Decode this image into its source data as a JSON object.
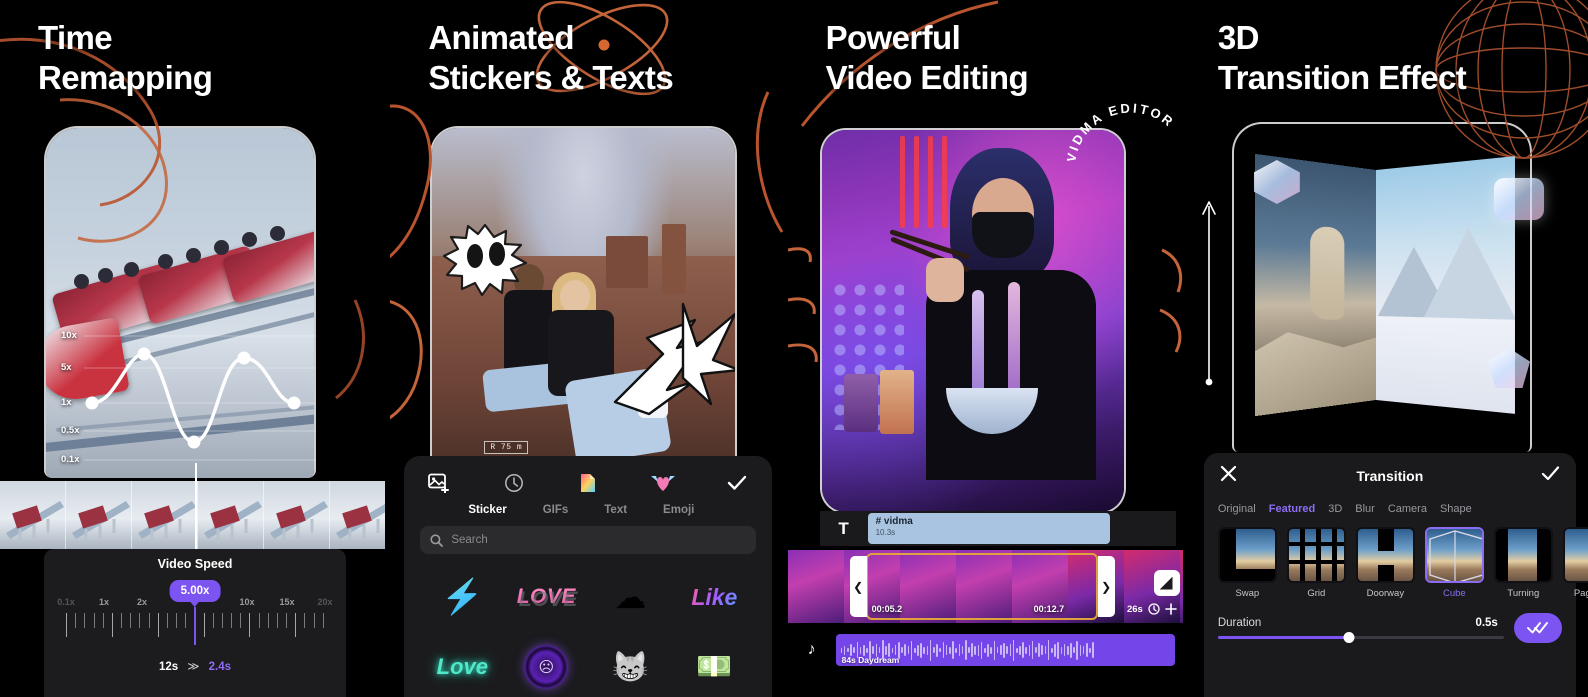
{
  "panels": [
    {
      "headline_line1": "Time",
      "headline_line2": "Remapping",
      "graph_labels": [
        "10x",
        "5x",
        "1x",
        "0.5x",
        "0.1x"
      ],
      "tray_title": "Video Speed",
      "ruler_labels": [
        "0.1x",
        "1x",
        "2x",
        "5x",
        "10x",
        "15x",
        "20x"
      ],
      "speed_badge": "5.00x",
      "duration_from": "12s",
      "duration_arrow": "≫",
      "duration_to": "2.4s"
    },
    {
      "headline_line1": "Animated",
      "headline_line2": "Stickers & Texts",
      "plate_label": "R 75 m",
      "toolbar": {
        "add_media_icon": "add-image-icon",
        "recent_icon": "clock-icon",
        "text_icon": "text-icon",
        "emoji_icon": "winged-heart-icon",
        "confirm_icon": "check-icon"
      },
      "tabs": [
        "Sticker",
        "GIFs",
        "Text",
        "Emoji"
      ],
      "active_tab": "Sticker",
      "search_placeholder": "Search",
      "stickers": [
        {
          "name": "lightning-bolt-sticker",
          "glyph": "⚡"
        },
        {
          "name": "love-3d-sticker",
          "glyph": "LOVE"
        },
        {
          "name": "cloud-puff-sticker",
          "glyph": "☁"
        },
        {
          "name": "like-sticker",
          "glyph": "Like"
        },
        {
          "name": "love-neon-sticker",
          "glyph": "Love"
        },
        {
          "name": "purple-disc-sticker",
          "glyph": "☹"
        },
        {
          "name": "cool-cat-sticker",
          "glyph": "🐱"
        },
        {
          "name": "money-sticker",
          "glyph": "💵"
        }
      ]
    },
    {
      "headline_line1": "Powerful",
      "headline_line2": "Video Editing",
      "watermark": "VIDMA EDITOR",
      "text_track": {
        "icon": "T",
        "clip_title": "# vidma",
        "clip_duration": "10.3s"
      },
      "timeline": {
        "start_time": "00:05.2",
        "end_time": "00:12.7",
        "total_duration": "26s",
        "split_icon": "split-icon",
        "speed_icon": "clock-icon",
        "add_icon": "plus-icon"
      },
      "audio": {
        "icon": "music-note-icon",
        "label": "84s Daydream"
      }
    },
    {
      "headline_line1": "3D",
      "headline_line2": "Transition Effect",
      "sheet": {
        "close_icon": "close-icon",
        "title": "Transition",
        "confirm_icon": "check-icon",
        "categories": [
          "Original",
          "Featured",
          "3D",
          "Blur",
          "Camera",
          "Shape"
        ],
        "active_category": "Featured",
        "transitions": [
          {
            "name": "Swap",
            "selected": false
          },
          {
            "name": "Grid",
            "selected": false
          },
          {
            "name": "Doorway",
            "selected": false
          },
          {
            "name": "Cube",
            "selected": true
          },
          {
            "name": "Turning",
            "selected": false
          },
          {
            "name": "Page Cu",
            "selected": false
          }
        ],
        "duration_label": "Duration",
        "duration_value": "0.5s",
        "apply_all_icon": "double-check-icon"
      }
    }
  ],
  "colors": {
    "accent_purple": "#7c54f2",
    "accent_purple_text": "#8c6cf3",
    "selection_orange": "#e0a23c",
    "deco_orange": "#c4643a",
    "text_clip_blue": "#a9c4e0"
  }
}
